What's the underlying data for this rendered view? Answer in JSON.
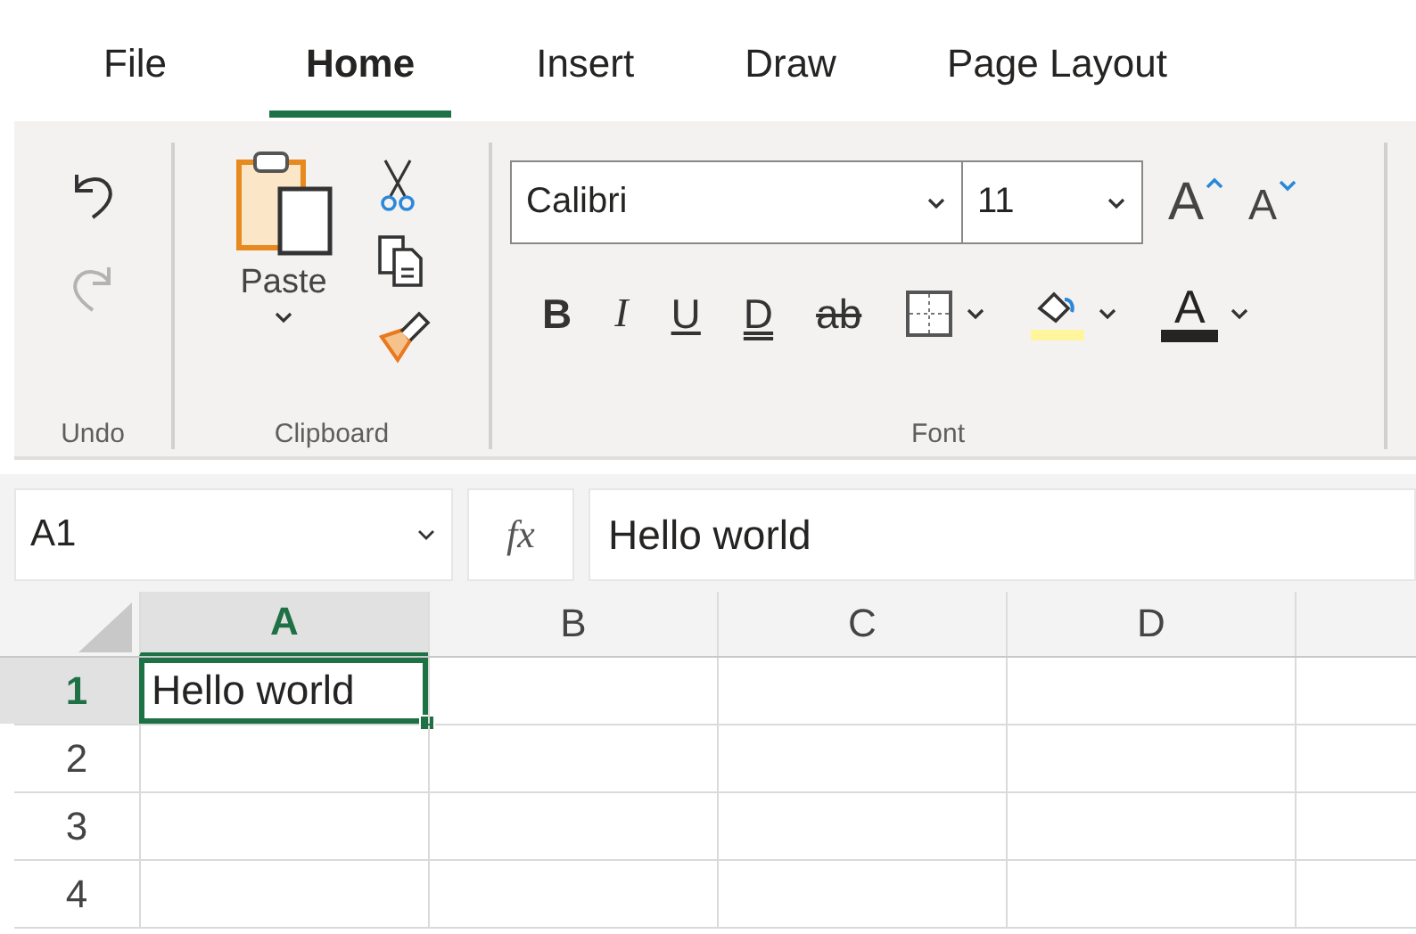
{
  "tabs": [
    {
      "label": "File",
      "selected": false
    },
    {
      "label": "Home",
      "selected": true
    },
    {
      "label": "Insert",
      "selected": false
    },
    {
      "label": "Draw",
      "selected": false
    },
    {
      "label": "Page Layout",
      "selected": false
    }
  ],
  "ribbon": {
    "undo": {
      "label": "Undo",
      "buttons": [
        {
          "kind": "undo",
          "disabled": false
        },
        {
          "kind": "redo",
          "disabled": true
        }
      ]
    },
    "clipboard": {
      "label": "Clipboard",
      "paste_label": "Paste"
    },
    "font": {
      "label": "Font",
      "font_name": "Calibri",
      "font_size": "11",
      "grow_label": "A",
      "shrink_label": "A",
      "format_buttons": [
        {
          "kind": "bold",
          "text": "B"
        },
        {
          "kind": "italic",
          "text": "I"
        },
        {
          "kind": "underline",
          "text": "U"
        },
        {
          "kind": "double_underline",
          "text": "D"
        },
        {
          "kind": "strikethrough",
          "text": "ab"
        }
      ],
      "font_color_label": "A"
    }
  },
  "name_box": {
    "value": "A1"
  },
  "formula_bar": {
    "label": "fx",
    "value": "Hello world"
  },
  "grid": {
    "columns": [
      {
        "label": "A",
        "selected": true
      },
      {
        "label": "B",
        "selected": false
      },
      {
        "label": "C",
        "selected": false
      },
      {
        "label": "D",
        "selected": false
      }
    ],
    "rows": [
      {
        "label": "1",
        "selected": true,
        "cells": [
          {
            "text": "Hello world",
            "selected": true
          }
        ]
      },
      {
        "label": "2",
        "selected": false
      },
      {
        "label": "3",
        "selected": false
      },
      {
        "label": "4",
        "selected": false
      }
    ]
  }
}
